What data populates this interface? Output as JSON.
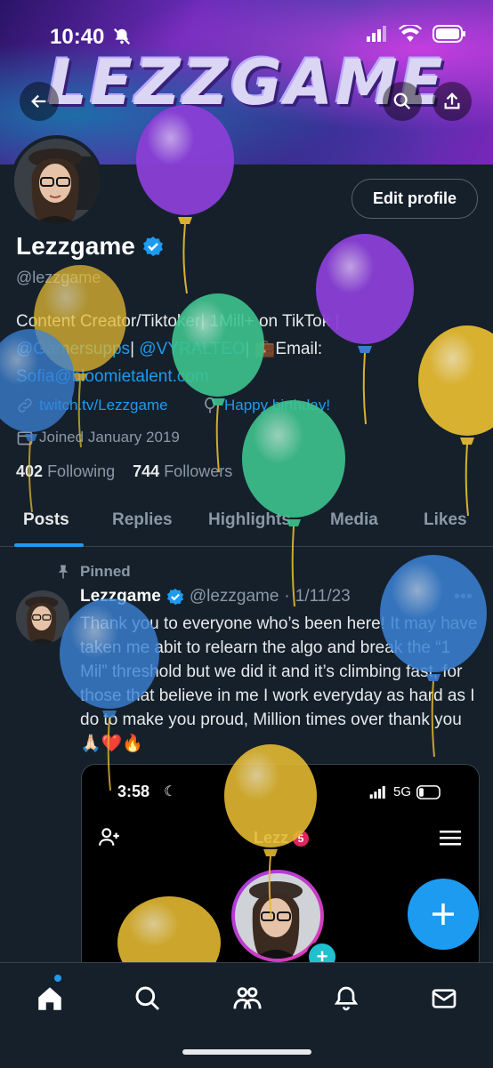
{
  "status_bar": {
    "time": "10:40"
  },
  "banner": {
    "title": "LEZZGAME"
  },
  "profile": {
    "edit_label": "Edit profile",
    "display_name": "Lezzgame",
    "handle": "@lezzgame",
    "bio_part1": "Content Creator/Tiktoker| 1Mill+ on TikTok |",
    "bio_mention1": "@Gamersupps",
    "bio_sep": "| ",
    "bio_mention2": "@VYRALTEO",
    "bio_part2": "| 💼Email:",
    "bio_email": "Sofia@bloomietalent.com",
    "website": "twitch.tv/Lezzgame",
    "birthday": "Happy birthday!",
    "joined": "Joined January 2019",
    "following_count": "402",
    "following_label": "Following",
    "followers_count": "744",
    "followers_label": "Followers"
  },
  "tabs": [
    {
      "label": "Posts",
      "active": true
    },
    {
      "label": "Replies",
      "active": false
    },
    {
      "label": "Highlights",
      "active": false
    },
    {
      "label": "Media",
      "active": false
    },
    {
      "label": "Likes",
      "active": false
    }
  ],
  "pinned_post": {
    "pinned_label": "Pinned",
    "author": "Lezzgame",
    "handle": "@lezzgame",
    "separator": "·",
    "date": "1/11/23",
    "text": "Thank you to everyone who’s been here! It may have taken me abit to relearn the algo and break the “1 Mil” threshold but we did it and it’s climbing fast, for those that believe in me I work everyday as hard as I do to make you proud, Million times over thank you 🙏🏻❤️🔥"
  },
  "embed": {
    "time": "3:58",
    "network": "5G",
    "title": "Lezz",
    "badge": "5"
  },
  "colors": {
    "accent": "#1d9bf0",
    "background": "#15202b"
  },
  "balloon_colors": {
    "purple": "#8a3fd6",
    "green": "#3ec48e",
    "yellow": "#e3b931",
    "blue": "#3b82d6"
  }
}
